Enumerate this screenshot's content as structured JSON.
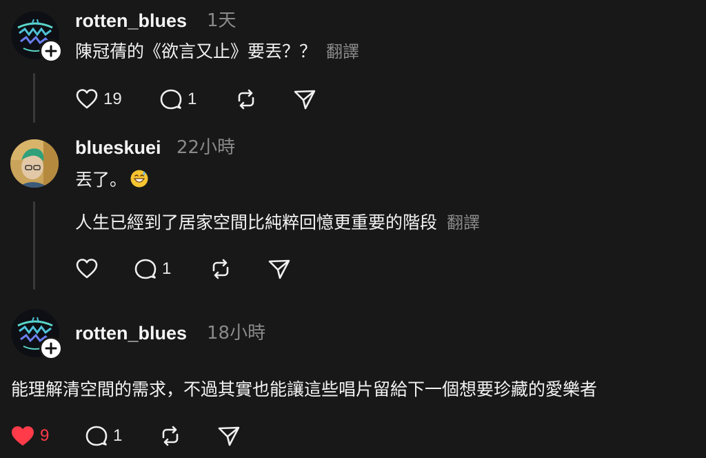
{
  "comments": [
    {
      "username": "rotten_blues",
      "time": "1天",
      "lines": [
        "陳冠蒨的《欲言又止》要丟？？"
      ],
      "translate": "翻譯",
      "likes": "19",
      "replies": "1",
      "liked": false,
      "avatar_icon": "rotten-blues-logo-icon"
    },
    {
      "username": "blueskuei",
      "time": "22小時",
      "lines": [
        "丟了。",
        "人生已經到了居家空間比純粹回憶更重要的階段"
      ],
      "translate": "翻譯",
      "likes": "",
      "replies": "1",
      "liked": false,
      "emoji": "grinning-sweat-emoji"
    },
    {
      "username": "rotten_blues",
      "time": "18小時",
      "lines": [
        "能理解清空間的需求，不過其實也能讓這些唱片留給下一個想要珍藏的愛樂者"
      ],
      "likes": "9",
      "replies": "1",
      "liked": true,
      "avatar_icon": "rotten-blues-logo-icon"
    }
  ],
  "colors": {
    "background": "#181818",
    "text": "#f3f3f3",
    "muted": "#8a8a8a",
    "like_red": "#ff3b4a",
    "thread_line": "#3a3a3a"
  }
}
